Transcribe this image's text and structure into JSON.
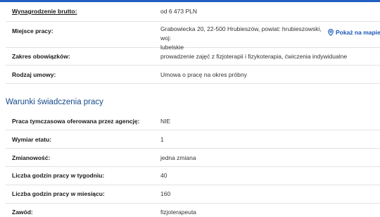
{
  "salary": {
    "label": "Wynagrodzenie brutto:",
    "value": "od 6 473 PLN"
  },
  "location": {
    "label": "Miejsce pracy:",
    "value_line1": "Grabowiecka 20, 22-500 Hrubieszów, powiat: hrubieszowski, woj:",
    "value_line2": "lubelskie",
    "map_link": "Pokaż na mapie",
    "icon": "map-pin-icon"
  },
  "duties": {
    "label": "Zakres obowiązków:",
    "value": "prowadzenie zajęć z fizjoterapii i fizykoterapia, ćwiczenia indywidualne"
  },
  "contract": {
    "label": "Rodzaj umowy:",
    "value": "Umowa o pracę na okres próbny"
  },
  "conditions": {
    "title": "Warunki świadczenia pracy",
    "rows": [
      {
        "label": "Praca tymczasowa oferowana przez agencję:",
        "value": "NIE"
      },
      {
        "label": "Wymiar etatu:",
        "value": "1"
      },
      {
        "label": "Zmianowość:",
        "value": "jedna zmiana"
      },
      {
        "label": "Liczba godzin pracy w tygodniu:",
        "value": "40"
      },
      {
        "label": "Liczba godzin pracy w miesiącu:",
        "value": "160"
      },
      {
        "label": "Zawód:",
        "value": "fizjoterapeuta"
      }
    ]
  },
  "colors": {
    "accent": "#1f5fbf",
    "section_title": "#174a8c",
    "link": "#1a56b8"
  }
}
